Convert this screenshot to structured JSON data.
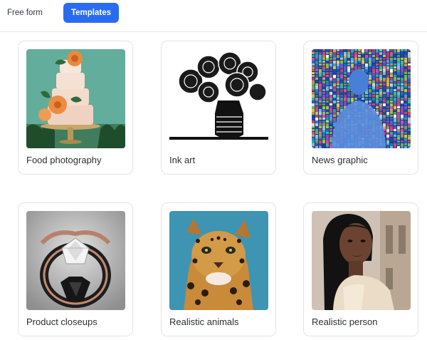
{
  "tabs": {
    "free_form": "Free form",
    "templates": "Templates"
  },
  "accent_color": "#2a6cf0",
  "templates": [
    {
      "label": "Food photography",
      "image": "tiered-cake-with-orange-flowers"
    },
    {
      "label": "Ink art",
      "image": "ink-roses-in-vase"
    },
    {
      "label": "News graphic",
      "image": "pixel-data-figure"
    },
    {
      "label": "Product closeups",
      "image": "diamond-ring"
    },
    {
      "label": "Realistic animals",
      "image": "ocelot"
    },
    {
      "label": "Realistic person",
      "image": "woman-portrait"
    }
  ]
}
